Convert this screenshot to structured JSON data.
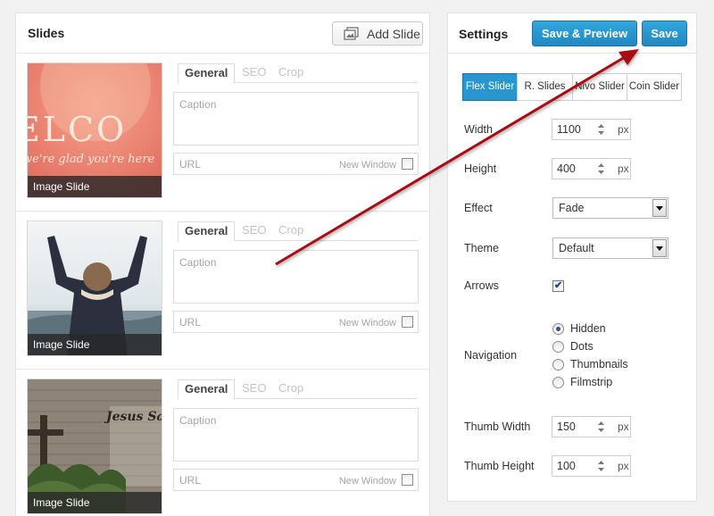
{
  "slides_panel": {
    "title": "Slides",
    "add_button": "Add Slide",
    "tabs": [
      "General",
      "SEO",
      "Crop"
    ],
    "slides": [
      {
        "label": "Image Slide",
        "caption_placeholder": "Caption",
        "url_placeholder": "URL",
        "new_window": "New Window",
        "thumb_text": "ELCO",
        "thumb_subtext": "we're glad you're here"
      },
      {
        "label": "Image Slide",
        "caption_placeholder": "Caption",
        "url_placeholder": "URL",
        "new_window": "New Window"
      },
      {
        "label": "Image Slide",
        "caption_placeholder": "Caption",
        "url_placeholder": "URL",
        "new_window": "New Window",
        "thumb_text": "Jesus Saves"
      }
    ]
  },
  "settings": {
    "title": "Settings",
    "save_preview": "Save & Preview",
    "save": "Save",
    "library_tabs": [
      "Flex Slider",
      "R. Slides",
      "Nivo Slider",
      "Coin Slider"
    ],
    "width_label": "Width",
    "width_value": "1100",
    "height_label": "Height",
    "height_value": "400",
    "unit": "px",
    "effect_label": "Effect",
    "effect_value": "Fade",
    "theme_label": "Theme",
    "theme_value": "Default",
    "arrows_label": "Arrows",
    "arrows_checked": true,
    "navigation_label": "Navigation",
    "navigation_options": [
      "Hidden",
      "Dots",
      "Thumbnails",
      "Filmstrip"
    ],
    "navigation_selected": "Hidden",
    "thumb_width_label": "Thumb Width",
    "thumb_width_value": "150",
    "thumb_height_label": "Thumb Height",
    "thumb_height_value": "100"
  },
  "colors": {
    "accent_blue": "#2897cf",
    "annotation_arrow": "#a80f12"
  }
}
